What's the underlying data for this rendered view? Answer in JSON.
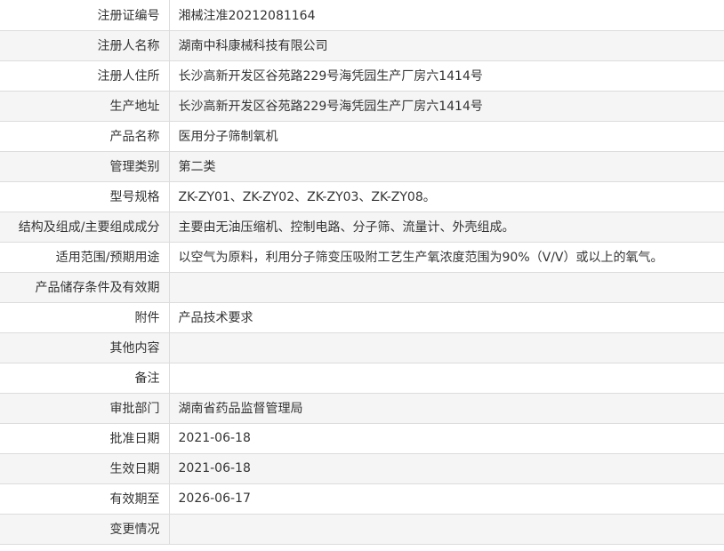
{
  "rows": [
    {
      "label": "注册证编号",
      "value": "湘械注准20212081164"
    },
    {
      "label": "注册人名称",
      "value": "湖南中科康械科技有限公司"
    },
    {
      "label": "注册人住所",
      "value": "长沙高新开发区谷苑路229号海凭园生产厂房六1414号"
    },
    {
      "label": "生产地址",
      "value": "长沙高新开发区谷苑路229号海凭园生产厂房六1414号"
    },
    {
      "label": "产品名称",
      "value": "医用分子筛制氧机"
    },
    {
      "label": "管理类别",
      "value": "第二类"
    },
    {
      "label": "型号规格",
      "value": "ZK-ZY01、ZK-ZY02、ZK-ZY03、ZK-ZY08。"
    },
    {
      "label": "结构及组成/主要组成成分",
      "value": "主要由无油压缩机、控制电路、分子筛、流量计、外壳组成。"
    },
    {
      "label": "适用范围/预期用途",
      "value": "以空气为原料，利用分子筛变压吸附工艺生产氧浓度范围为90%（V/V）或以上的氧气。"
    },
    {
      "label": "产品储存条件及有效期",
      "value": ""
    },
    {
      "label": "附件",
      "value": "产品技术要求"
    },
    {
      "label": "其他内容",
      "value": ""
    },
    {
      "label": "备注",
      "value": ""
    },
    {
      "label": "审批部门",
      "value": "湖南省药品监督管理局"
    },
    {
      "label": "批准日期",
      "value": "2021-06-18"
    },
    {
      "label": "生效日期",
      "value": "2021-06-18"
    },
    {
      "label": "有效期至",
      "value": "2026-06-17"
    },
    {
      "label": "变更情况",
      "value": ""
    }
  ]
}
